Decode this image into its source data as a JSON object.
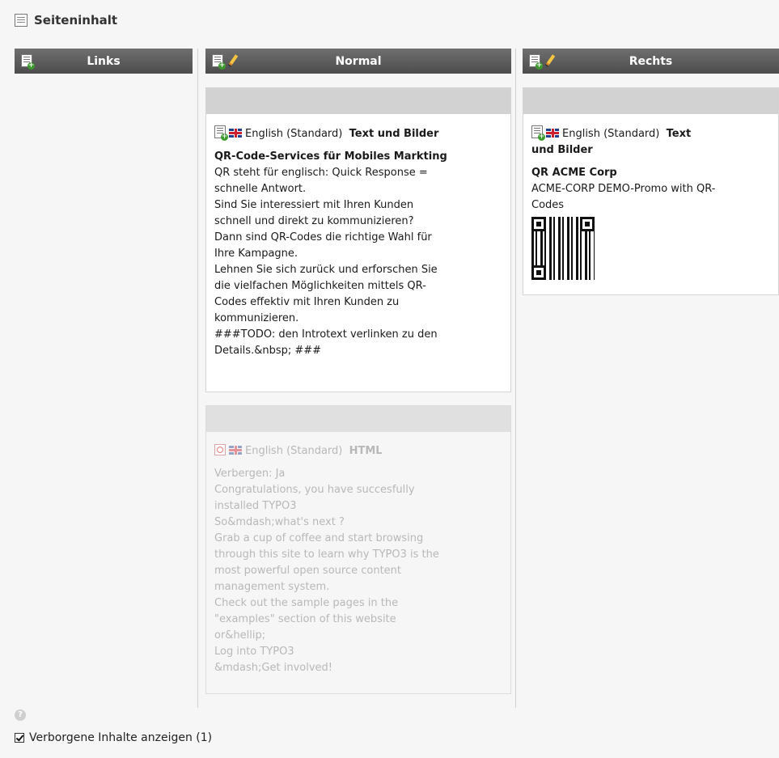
{
  "page": {
    "title": "Seiteninhalt"
  },
  "columns": [
    {
      "id": "links",
      "title": "Links",
      "has_edit": false
    },
    {
      "id": "normal",
      "title": "Normal",
      "has_edit": true
    },
    {
      "id": "rechts",
      "title": "Rechts",
      "has_edit": true
    }
  ],
  "normal_elements": [
    {
      "hidden": false,
      "language": "English (Standard)",
      "type_label": "Text und Bilder",
      "heading": "QR-Code-Services für Mobiles Markting",
      "lines": [
        "QR steht für englisch: Quick Response =",
        "schnelle Antwort.",
        "Sind Sie interessiert mit Ihren Kunden",
        "schnell und direkt zu kommunizieren?",
        "Dann sind QR-Codes die richtige Wahl für",
        "Ihre Kampagne.",
        "Lehnen Sie sich zurück und erforschen Sie",
        "die vielfachen Möglichkeiten mittels QR-",
        "Codes effektiv mit Ihren Kunden zu",
        "kommunizieren.",
        "###TODO: den Introtext verlinken zu den",
        "Details.&nbsp; ###"
      ]
    },
    {
      "hidden": true,
      "language": "English (Standard)",
      "type_label": "HTML",
      "lines": [
        "Verbergen: Ja",
        "Congratulations, you have succesfully",
        "installed TYPO3",
        "So&mdash;what's next ?",
        "Grab a cup of coffee and start browsing",
        "through this site to learn why TYPO3 is the",
        "most powerful open source content",
        "management system.",
        "Check out the sample pages in the",
        "\"examples\" section of this website",
        "or&hellip;",
        "Log into TYPO3",
        "&mdash;Get involved!"
      ]
    }
  ],
  "rechts_elements": [
    {
      "hidden": false,
      "language": "English (Standard)",
      "type_label_1": "Text",
      "type_label_2": "und Bilder",
      "heading": "QR ACME Corp",
      "lines": [
        "ACME-CORP DEMO-Promo with QR-",
        "Codes"
      ],
      "has_qr_image": true
    }
  ],
  "footer": {
    "show_hidden_label": "Verborgene Inhalte anzeigen (1)",
    "show_hidden_checked": true,
    "help_icon_glyph": "?"
  },
  "colors": {
    "header_bar": "#5c5c5c",
    "element_bar": "#d2d2d2",
    "hidden_text": "#b8b8b8"
  }
}
